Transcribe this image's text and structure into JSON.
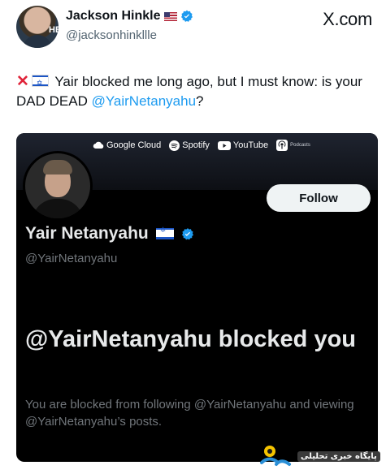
{
  "tweet": {
    "author_name": "Jackson Hinkle",
    "author_handle": "@jacksonhinkllle",
    "avatar_tag": "HB",
    "source": "X.com",
    "text_part1": " Yair blocked me long ago, but I must know: is your DAD DEAD ",
    "mention": "@YairNetanyahu",
    "text_part2": "?"
  },
  "embed": {
    "sponsors": [
      "Google Cloud",
      "Spotify",
      "YouTube",
      "Podcasts"
    ],
    "follow_label": "Follow",
    "profile_name": "Yair Netanyahu",
    "profile_handle": "@YairNetanyahu",
    "blocked_title": "@YairNetanyahu blocked you",
    "blocked_desc": "You are blocked from following @YairNetanyahu and viewing @YairNetanyahu’s posts."
  },
  "watermark": {
    "text": "پایگاه خبری تحلیلی"
  },
  "colors": {
    "link": "#1d9bf0",
    "embed_bg": "#000000",
    "follow_bg": "#eff3f4",
    "muted": "#71767b",
    "cross": "#e0243a"
  },
  "icons": [
    "verified-badge-icon",
    "us-flag-icon",
    "israel-flag-icon",
    "cross-mark-icon",
    "x-logo-icon"
  ]
}
